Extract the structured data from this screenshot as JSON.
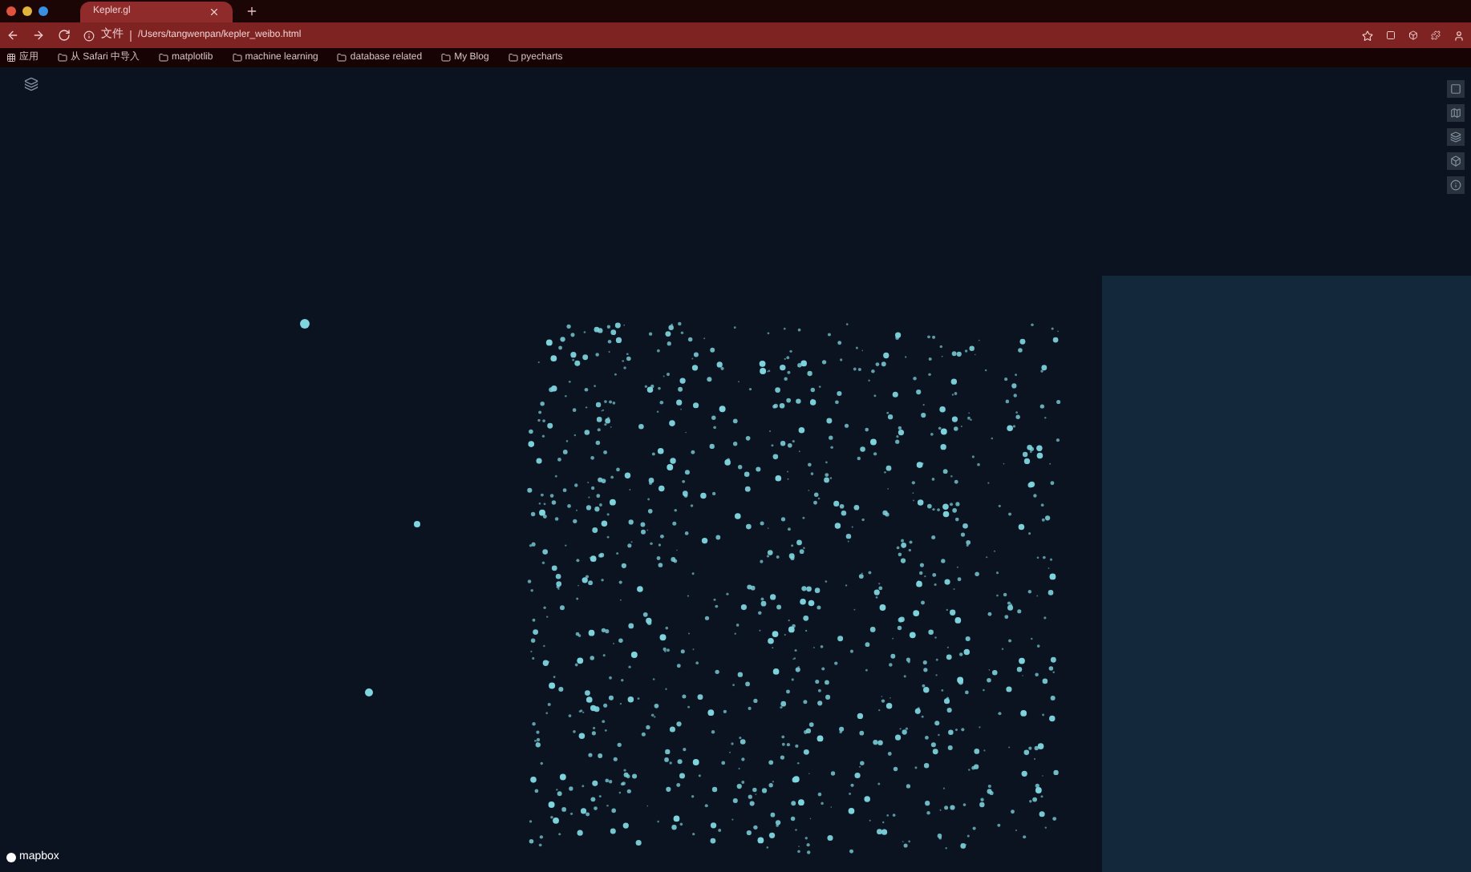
{
  "browser": {
    "tab": {
      "title": "Kepler.gl",
      "selected": true
    },
    "security_label": "文件",
    "url": "/Users/tangwenpan/kepler_weibo.html"
  },
  "bookmarks": [
    {
      "kind": "apps",
      "label": "应用"
    },
    {
      "kind": "folder",
      "label": "从 Safari 中导入"
    },
    {
      "kind": "folder",
      "label": "matplotlib"
    },
    {
      "kind": "folder",
      "label": "machine learning"
    },
    {
      "kind": "folder",
      "label": "database related"
    },
    {
      "kind": "folder",
      "label": "My Blog"
    },
    {
      "kind": "folder",
      "label": "pyecharts"
    }
  ],
  "map": {
    "attribution": "mapbox"
  }
}
